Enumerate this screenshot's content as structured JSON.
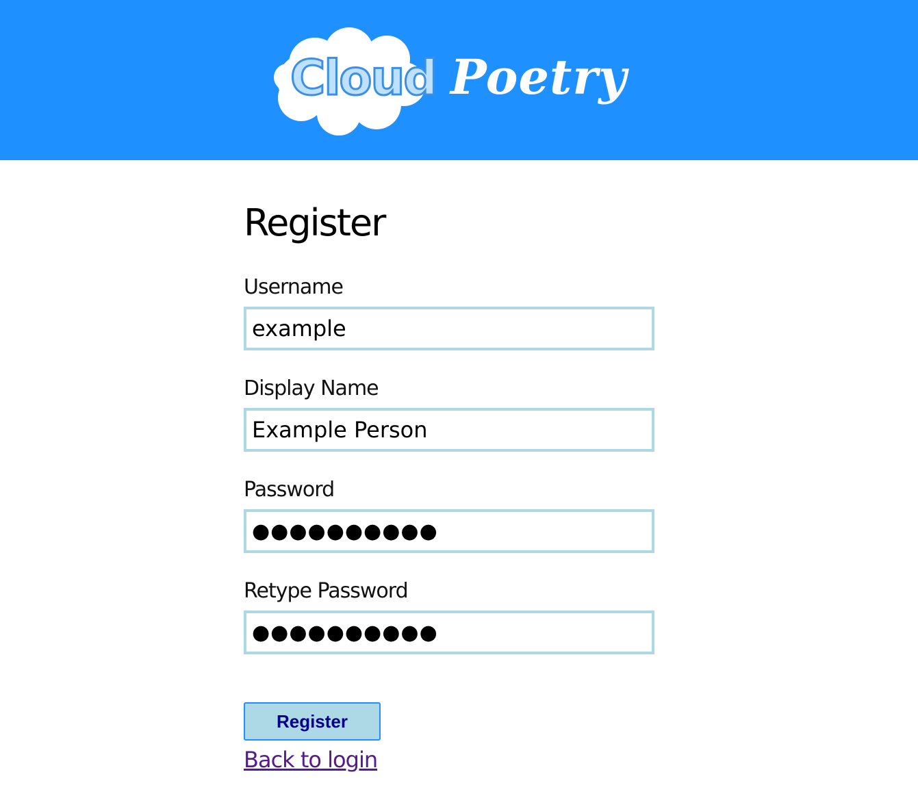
{
  "header": {
    "logo": {
      "text_part1": "Cloud",
      "text_part2": "Poetry",
      "icon": "cloud-icon"
    },
    "background_color": "#1e90ff"
  },
  "form": {
    "title": "Register",
    "fields": [
      {
        "label": "Username",
        "value": "example",
        "type": "text"
      },
      {
        "label": "Display Name",
        "value": "Example Person",
        "type": "text"
      },
      {
        "label": "Password",
        "value": "●●●●●●●●●●",
        "type": "password"
      },
      {
        "label": "Retype Password",
        "value": "●●●●●●●●●●",
        "type": "password"
      }
    ],
    "submit_label": "Register",
    "back_link_label": "Back to login"
  },
  "colors": {
    "input_border": "#add8e6",
    "button_bg": "#add8e6",
    "button_border": "#1e90ff",
    "button_text": "#00008b",
    "link": "#551a8b"
  }
}
